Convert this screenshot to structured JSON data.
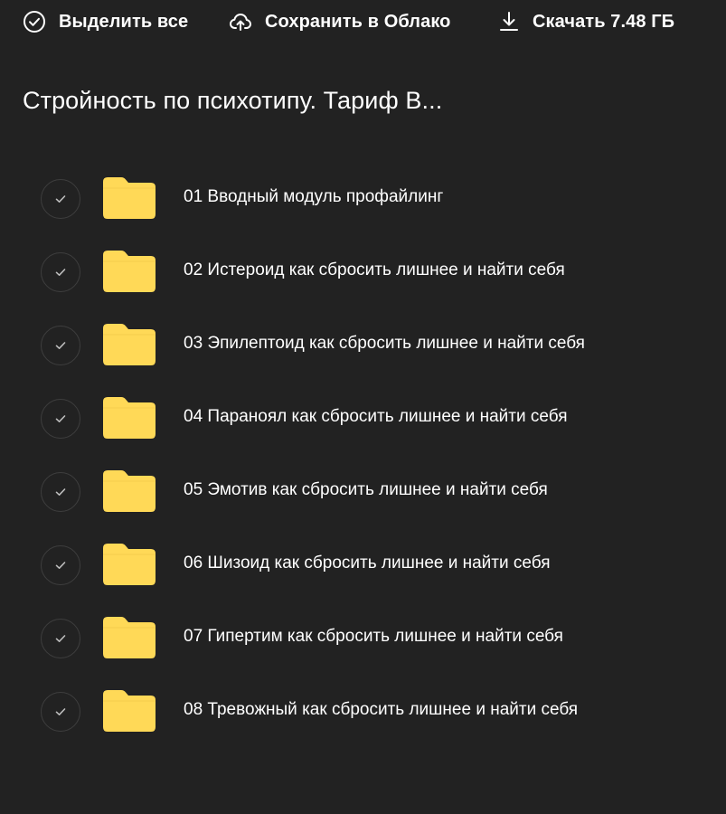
{
  "toolbar": {
    "select_all_label": "Выделить все",
    "save_to_cloud_label": "Сохранить в Облако",
    "download_label": "Скачать 7.48 ГБ"
  },
  "folder": {
    "title": "Стройность по психотипу. Тариф В..."
  },
  "items": [
    {
      "name": "01 Вводный модуль профайлинг",
      "type": "folder"
    },
    {
      "name": "02 Истероид как сбросить лишнее и найти себя",
      "type": "folder"
    },
    {
      "name": "03 Эпилептоид как сбросить лишнее и найти себя",
      "type": "folder"
    },
    {
      "name": "04 Параноял как сбросить лишнее и найти себя",
      "type": "folder"
    },
    {
      "name": "05 Эмотив как сбросить лишнее и найти себя",
      "type": "folder"
    },
    {
      "name": "06 Шизоид как сбросить лишнее и найти себя",
      "type": "folder"
    },
    {
      "name": "07 Гипертим как сбросить лишнее и найти себя",
      "type": "folder"
    },
    {
      "name": "08 Тревожный как сбросить лишнее и найти себя",
      "type": "folder"
    }
  ],
  "icons": {
    "select_all": "check-circle-icon",
    "save_to_cloud": "cloud-upload-icon",
    "download": "download-icon",
    "row_check": "check-icon",
    "folder": "folder-icon"
  },
  "colors": {
    "background": "#222222",
    "text": "#ffffff",
    "folder": "#ffd957",
    "check_circle_border": "#3e3e3e",
    "check_mark": "#bdbdbd"
  }
}
